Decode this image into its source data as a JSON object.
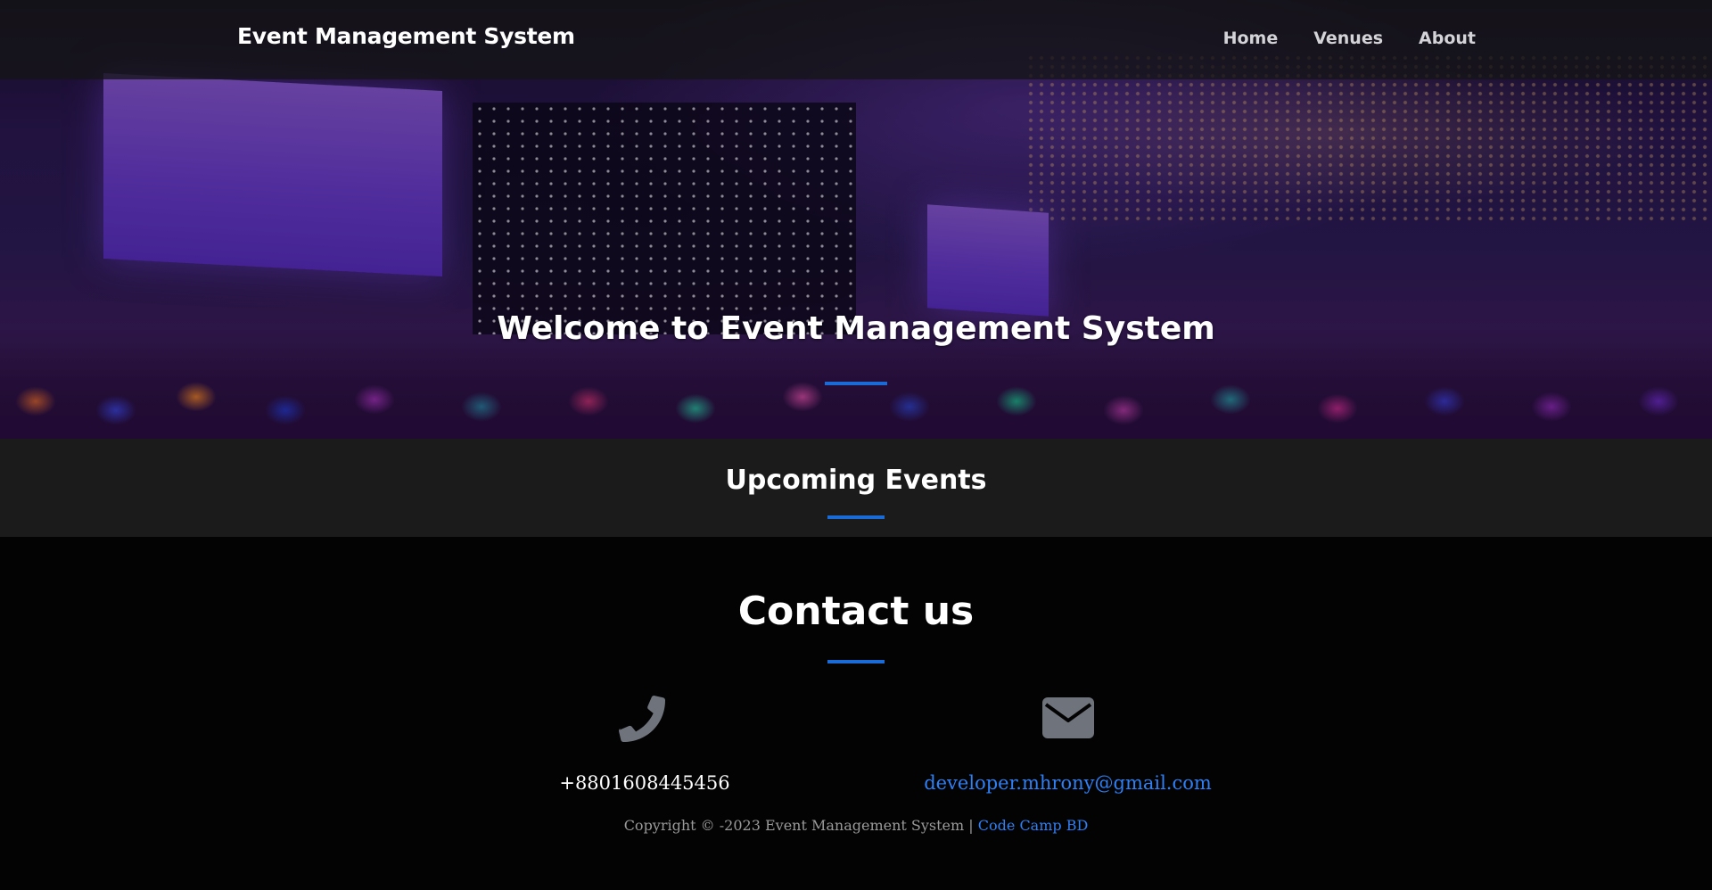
{
  "navbar": {
    "brand": "Event Management System",
    "links": [
      {
        "label": "Home"
      },
      {
        "label": "Venues"
      },
      {
        "label": "About"
      }
    ]
  },
  "hero": {
    "title": "Welcome to Event Management System"
  },
  "events": {
    "title": "Upcoming Events"
  },
  "contact": {
    "title": "Contact us",
    "phone": {
      "icon": "phone-icon",
      "value": "+8801608445456"
    },
    "email": {
      "icon": "envelope-icon",
      "value": "developer.mhrony@gmail.com"
    }
  },
  "footer": {
    "copyright_text": "Copyright © -2023 Event Management System |",
    "credit_link": "Code Camp BD"
  },
  "colors": {
    "accent": "#1a6bd8",
    "link": "#2f7ff5",
    "icon_gray": "#6f737b"
  }
}
